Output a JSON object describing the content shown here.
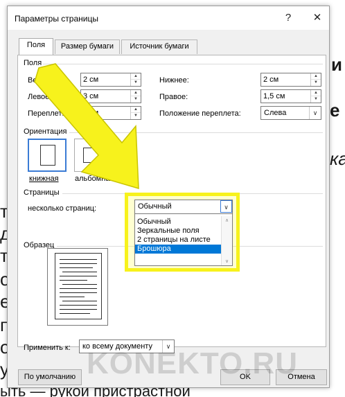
{
  "background_text": {
    "line1": "и",
    "line2": "е",
    "line3": "ка",
    "line4": "то",
    "line5": "д",
    "line6": "т",
    "line7": "о",
    "line8": "е д",
    "line9": "по",
    "line10": "ов",
    "line11": "ул",
    "line12": "ыть — рукой пристрастной"
  },
  "dialog": {
    "title": "Параметры страницы",
    "help_label": "?",
    "close_label": "✕"
  },
  "tabs": [
    {
      "label": "Поля"
    },
    {
      "label": "Размер бумаги"
    },
    {
      "label": "Источник бумаги"
    }
  ],
  "margins": {
    "group_label": "Поля",
    "top_label": "Верхнее:",
    "top_value": "2 см",
    "bottom_label": "Нижнее:",
    "bottom_value": "2 см",
    "left_label": "Левое:",
    "left_value": "3 см",
    "right_label": "Правое:",
    "right_value": "1,5 см",
    "gutter_label": "Переплет:",
    "gutter_value": "0 см",
    "gutter_pos_label": "Положение переплета:",
    "gutter_pos_value": "Слева"
  },
  "orientation": {
    "group_label": "Ориентация",
    "portrait_label": "книжная",
    "landscape_label": "альбомная"
  },
  "pages": {
    "group_label": "Страницы",
    "multiple_label": "несколько страниц:",
    "selected_value": "Обычный",
    "options": [
      "Обычный",
      "Зеркальные поля",
      "2 страницы на листе",
      "Брошюра"
    ],
    "highlighted_option": "Брошюра"
  },
  "sample": {
    "group_label": "Образец"
  },
  "apply": {
    "label": "Применить к:",
    "value": "ко всему документу"
  },
  "buttons": {
    "default_label": "По умолчанию",
    "ok_label": "OK",
    "cancel_label": "Отмена"
  },
  "watermark": "KONEKTO.RU",
  "colors": {
    "highlight": "#f7f21c",
    "selection": "#0078d7",
    "arrow": "#f7f21c"
  }
}
